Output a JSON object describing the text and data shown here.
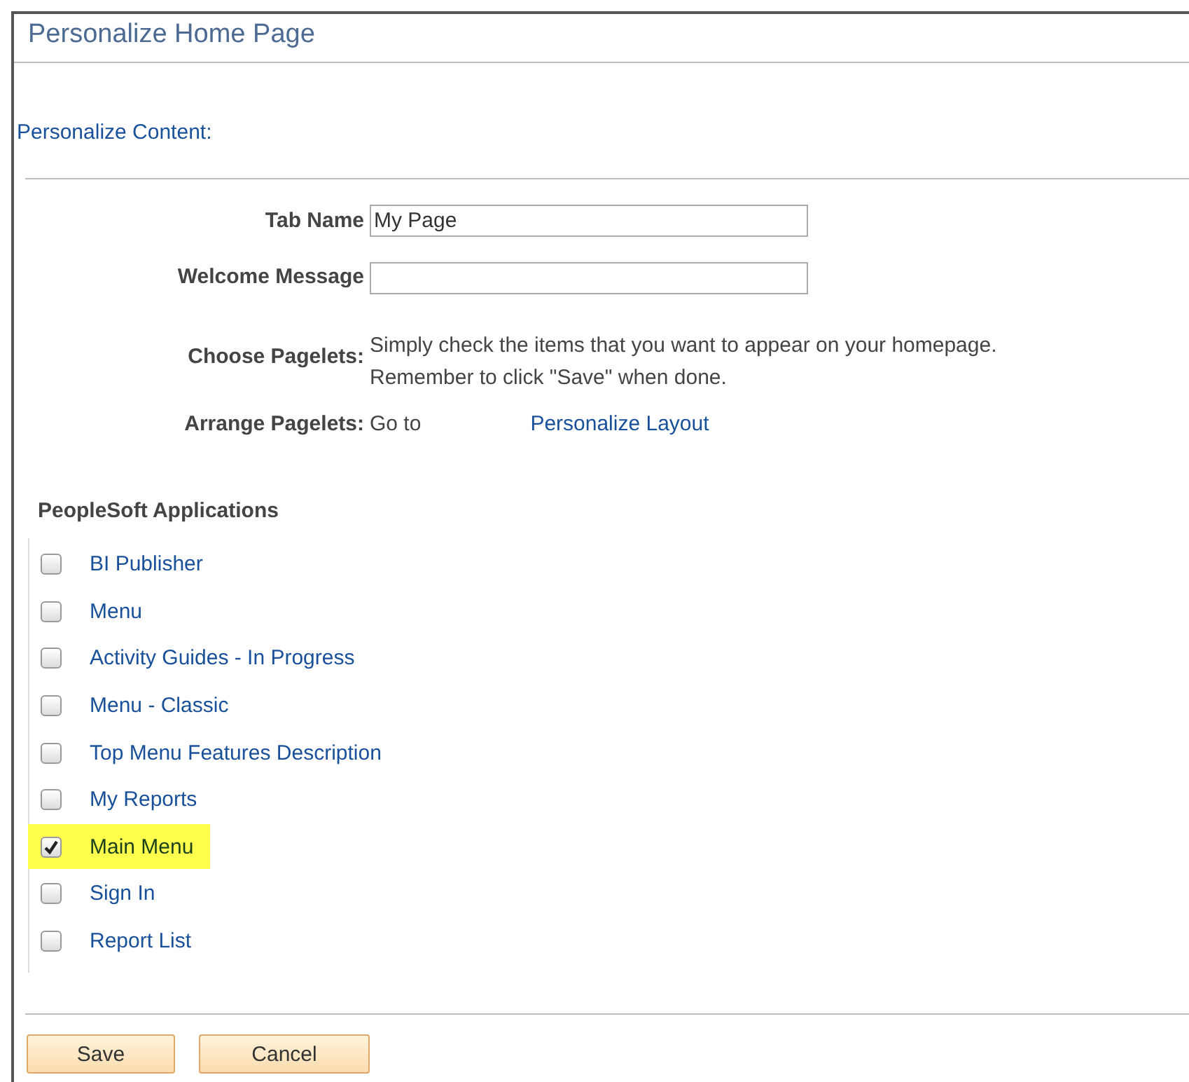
{
  "title": "Personalize Home Page",
  "section_link": "Personalize Content:",
  "fields": [
    {
      "label": "Tab Name",
      "value": "My Page"
    },
    {
      "label": "Welcome Message"
    }
  ],
  "choose": {
    "label": "Choose Pagelets:",
    "lines": [
      "Simply check the items that you want to appear on your homepage.",
      "Remember to click \"Save\" when done."
    ]
  },
  "arrange": {
    "label": "Arrange Pagelets:",
    "text": "Go to",
    "link": "Personalize Layout"
  },
  "group": {
    "title": "PeopleSoft Applications",
    "items": [
      {
        "label": "BI Publisher",
        "checked": false,
        "highlighted": false
      },
      {
        "label": "Menu",
        "checked": false,
        "highlighted": false
      },
      {
        "label": "Activity Guides - In Progress",
        "checked": false,
        "highlighted": false
      },
      {
        "label": "Menu - Classic",
        "checked": false,
        "highlighted": false
      },
      {
        "label": "Top Menu Features Description",
        "checked": false,
        "highlighted": false
      },
      {
        "label": "My Reports",
        "checked": false,
        "highlighted": false
      },
      {
        "label": "Main Menu",
        "checked": true,
        "highlighted": true
      },
      {
        "label": "Sign In",
        "checked": false,
        "highlighted": false
      },
      {
        "label": "Report List",
        "checked": false,
        "highlighted": false
      }
    ]
  },
  "buttons": [
    "Save",
    "Cancel"
  ]
}
